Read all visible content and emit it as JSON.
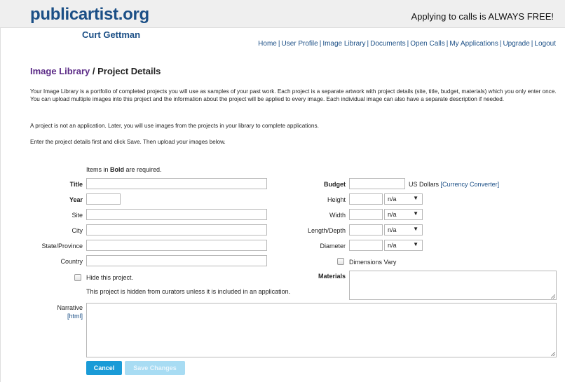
{
  "header": {
    "logo": "publicartist.org",
    "free_message": "Applying to calls is ALWAYS FREE!",
    "user_name": "Curt Gettman"
  },
  "nav": {
    "items": [
      "Home",
      "User Profile",
      "Image Library",
      "Documents",
      "Open Calls",
      "My Applications",
      "Upgrade",
      "Logout"
    ]
  },
  "page": {
    "title_link": "Image Library",
    "title_rest": " / Project Details",
    "intro": "Your Image Library is a portfolio of completed projects you will use as samples of your past work. Each project is a separate artwork with project details (site, title, budget, materials) which you only enter once. You can upload multiple images into this project and the information about the project will be applied to every image. Each individual image can also have a separate description if needed.",
    "note_application": "A project is not an application. Later, you will use images from the projects in your library to complete applications.",
    "instructions": "Enter the project details first and click Save. Then upload your images below.",
    "required_prefix": "Items in ",
    "required_bold": "Bold",
    "required_suffix": " are required."
  },
  "form": {
    "title_label": "Title",
    "title_value": "",
    "year_label": "Year",
    "year_value": "",
    "site_label": "Site",
    "site_value": "",
    "city_label": "City",
    "city_value": "",
    "state_label": "State/Province",
    "state_value": "",
    "country_label": "Country",
    "country_value": "",
    "hide_label": "Hide this project.",
    "hide_note": "This project is hidden from curators unless it is included in an application.",
    "budget_label": "Budget",
    "budget_value": "",
    "budget_unit": "US Dollars",
    "currency_link": "Currency Converter",
    "height_label": "Height",
    "height_value": "",
    "height_unit": "n/a",
    "width_label": "Width",
    "width_value": "",
    "width_unit": "n/a",
    "length_label": "Length/Depth",
    "length_value": "",
    "length_unit": "n/a",
    "diameter_label": "Diameter",
    "diameter_value": "",
    "diameter_unit": "n/a",
    "dimensions_vary_label": "Dimensions Vary",
    "materials_label": "Materials",
    "narrative_label": "Narrative",
    "narrative_html_link": "html"
  },
  "buttons": {
    "cancel": "Cancel",
    "save": "Save Changes"
  },
  "colors": {
    "brand_blue": "#1b4f86",
    "title_purple": "#5b2a86",
    "button_blue": "#1a9bd7",
    "button_disabled": "#a8dcf3"
  }
}
